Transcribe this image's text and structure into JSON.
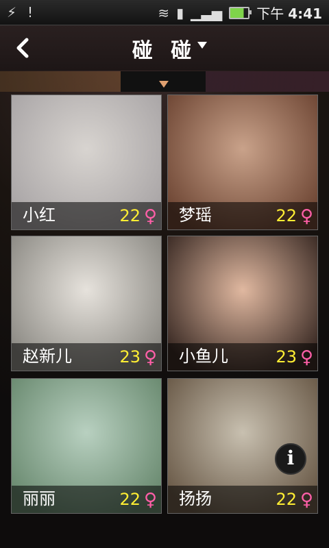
{
  "status_bar": {
    "left_icons": [
      "usb-icon",
      "warning-icon"
    ],
    "right_icons": [
      "wifi-icon",
      "sim-icon",
      "signal-icon",
      "battery-icon"
    ],
    "time_prefix": "下午",
    "time": "4:41"
  },
  "header": {
    "title": "碰 碰",
    "back_icon": "chevron-left-icon",
    "dropdown_icon": "caret-down-icon"
  },
  "profiles": [
    {
      "name": "小红",
      "age": "22",
      "gender": "♀",
      "photo_colors": [
        "#d8d4d0",
        "#a9a5a6"
      ]
    },
    {
      "name": "梦瑶",
      "age": "22",
      "gender": "♀",
      "photo_colors": [
        "#c9a28a",
        "#6e4634"
      ]
    },
    {
      "name": "赵新儿",
      "age": "23",
      "gender": "♀",
      "photo_colors": [
        "#e6e2dc",
        "#8c8a84"
      ]
    },
    {
      "name": "小鱼儿",
      "age": "23",
      "gender": "♀",
      "photo_colors": [
        "#e0b8a0",
        "#3a2a24"
      ]
    },
    {
      "name": "丽丽",
      "age": "22",
      "gender": "♀",
      "photo_colors": [
        "#b8d0c0",
        "#6a8a70"
      ]
    },
    {
      "name": "扬扬",
      "age": "22",
      "gender": "♀",
      "photo_colors": [
        "#c8c0b0",
        "#6a5a48"
      ],
      "has_info": true
    }
  ],
  "info_icon": "info-icon",
  "colors": {
    "age": "#ffee33",
    "female": "#ff5fa8"
  }
}
